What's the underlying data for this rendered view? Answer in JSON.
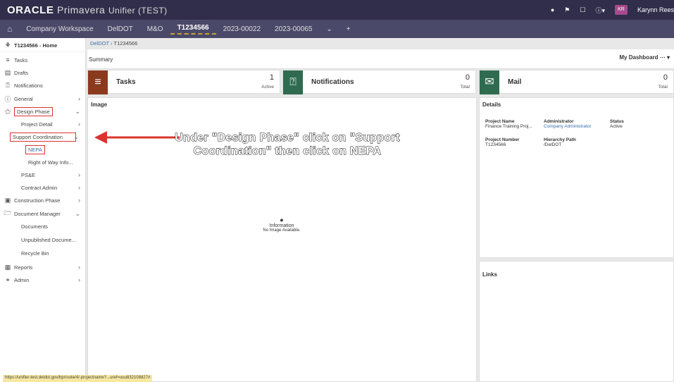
{
  "header": {
    "logo_oracle": "ORACLE",
    "logo_product": "Primavera",
    "logo_unifier": "Unifier (TEST)",
    "user_initials": "KR",
    "user_name": "Karynn Rees"
  },
  "tabs": [
    {
      "label": "Company Workspace"
    },
    {
      "label": "DelDOT"
    },
    {
      "label": "M&O"
    },
    {
      "label": "T1234566"
    },
    {
      "label": "2023-00022"
    },
    {
      "label": "2023-00065"
    },
    {
      "label": "+"
    }
  ],
  "sidebar": {
    "home": "T1234566 - Home",
    "items": [
      {
        "label": "Tasks"
      },
      {
        "label": "Drafts"
      },
      {
        "label": "Notifications"
      },
      {
        "label": "General"
      },
      {
        "label": "Design Phase"
      },
      {
        "label": "Project Detail"
      },
      {
        "label": "Support Coordination"
      },
      {
        "label": "NEPA"
      },
      {
        "label": "Right of Way Info..."
      },
      {
        "label": "PS&E"
      },
      {
        "label": "Contract Admin"
      },
      {
        "label": "Construction Phase"
      },
      {
        "label": "Document Manager"
      },
      {
        "label": "Documents"
      },
      {
        "label": "Unpublished Docume..."
      },
      {
        "label": "Recycle Bin"
      },
      {
        "label": "Reports"
      },
      {
        "label": "Admin"
      }
    ]
  },
  "breadcrumb": {
    "root": "DelDOT",
    "current": "T1234566"
  },
  "summary": {
    "title": "Summary",
    "dashboard": "My Dashboard"
  },
  "cards": {
    "tasks": {
      "title": "Tasks",
      "count": "1",
      "sub": "Active",
      "color": "#8b3a1e"
    },
    "notifications": {
      "title": "Notifications",
      "count": "0",
      "sub": "Total",
      "color": "#2e6b4f"
    },
    "mail": {
      "title": "Mail",
      "count": "0",
      "sub": "Total",
      "color": "#2e6b4f"
    }
  },
  "image_panel": {
    "title": "Image",
    "info_title": "Information",
    "info_text": "No Image Available."
  },
  "details": {
    "title": "Details",
    "project_name_label": "Project Name",
    "project_name": "Finance Training Proj...",
    "administrator_label": "Administrator",
    "administrator": "Company Administrator",
    "status_label": "Status",
    "status": "Active",
    "project_number_label": "Project Number",
    "project_number": "T1234566",
    "hierarchy_label": "Hierarchy Path",
    "hierarchy": "/DelDOT"
  },
  "links": {
    "title": "Links"
  },
  "callout": {
    "line1": "Under \"Design Phase\" click on \"Support",
    "line2": "Coordination\" then click on NEPA",
    "color": "#d9352e"
  },
  "status_bar": {
    "url": "https://unifier-test.deldot.gov/bp/route/4/-projectname?...uref=uuu832108827#"
  }
}
